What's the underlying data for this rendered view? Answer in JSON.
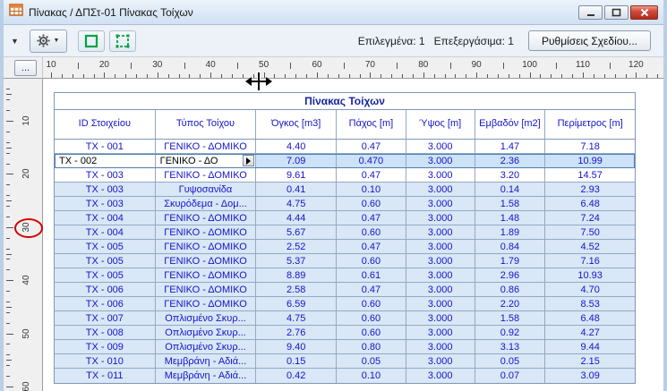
{
  "window": {
    "title": "Πίνακας / ΔΠΣτ-01 Πίνακας Τοίχων"
  },
  "toolbar": {
    "selected_label": "Επιλεγμένα:",
    "selected_count": "1",
    "editable_label": "Επεξεργάσιμα:",
    "editable_count": "1",
    "settings_button_label": "Ρυθμίσεις Σχεδίου..."
  },
  "rulers": {
    "corner_button_label": "...",
    "horizontal_labels": [
      10,
      20,
      30,
      40,
      50,
      60,
      70,
      80,
      90,
      100,
      110,
      120
    ],
    "vertical_labels": [
      10,
      20,
      30,
      40,
      50,
      60
    ]
  },
  "schedule": {
    "title": "Πίνακας Τοίχων",
    "columns": [
      "ID Στοιχείου",
      "Τύπος Τοίχου",
      "Όγκος [m3]",
      "Πάχος [m]",
      "Ύψος [m]",
      "Εμβαδόν [m2]",
      "Περίμετρος [m]"
    ],
    "rows": [
      {
        "id": "ΤΧ - 001",
        "type": "ΓΕΝΙΚΟ - ΔΟΜΙΚΟ",
        "volume": "4.40",
        "thickness": "0.47",
        "height": "3.000",
        "area": "1.47",
        "perimeter": "7.18",
        "state": "plain"
      },
      {
        "id": "ΤΧ - 002",
        "type": "ΓΕΝΙΚΟ - ΔΟ",
        "volume": "7.09",
        "thickness": "0.470",
        "height": "3.000",
        "area": "2.36",
        "perimeter": "10.99",
        "state": "selected"
      },
      {
        "id": "ΤΧ - 003",
        "type": "ΓΕΝΙΚΟ - ΔΟΜΙΚΟ",
        "volume": "9.61",
        "thickness": "0.47",
        "height": "3.000",
        "area": "3.20",
        "perimeter": "14.57",
        "state": "plain"
      },
      {
        "id": "ΤΧ - 003",
        "type": "Γυψοσανίδα",
        "volume": "0.41",
        "thickness": "0.10",
        "height": "3.000",
        "area": "0.14",
        "perimeter": "2.93",
        "state": "shaded"
      },
      {
        "id": "ΤΧ - 003",
        "type": "Σκυρόδεμα - Δομ...",
        "volume": "4.75",
        "thickness": "0.60",
        "height": "3.000",
        "area": "1.58",
        "perimeter": "6.48",
        "state": "shaded"
      },
      {
        "id": "ΤΧ - 004",
        "type": "ΓΕΝΙΚΟ - ΔΟΜΙΚΟ",
        "volume": "4.44",
        "thickness": "0.47",
        "height": "3.000",
        "area": "1.48",
        "perimeter": "7.24",
        "state": "shaded"
      },
      {
        "id": "ΤΧ - 004",
        "type": "ΓΕΝΙΚΟ - ΔΟΜΙΚΟ",
        "volume": "5.67",
        "thickness": "0.60",
        "height": "3.000",
        "area": "1.89",
        "perimeter": "7.50",
        "state": "shaded"
      },
      {
        "id": "ΤΧ - 005",
        "type": "ΓΕΝΙΚΟ - ΔΟΜΙΚΟ",
        "volume": "2.52",
        "thickness": "0.47",
        "height": "3.000",
        "area": "0.84",
        "perimeter": "4.52",
        "state": "shaded"
      },
      {
        "id": "ΤΧ - 005",
        "type": "ΓΕΝΙΚΟ - ΔΟΜΙΚΟ",
        "volume": "5.37",
        "thickness": "0.60",
        "height": "3.000",
        "area": "1.79",
        "perimeter": "7.16",
        "state": "shaded"
      },
      {
        "id": "ΤΧ - 005",
        "type": "ΓΕΝΙΚΟ - ΔΟΜΙΚΟ",
        "volume": "8.89",
        "thickness": "0.61",
        "height": "3.000",
        "area": "2.96",
        "perimeter": "10.93",
        "state": "shaded"
      },
      {
        "id": "ΤΧ - 006",
        "type": "ΓΕΝΙΚΟ - ΔΟΜΙΚΟ",
        "volume": "2.58",
        "thickness": "0.47",
        "height": "3.000",
        "area": "0.86",
        "perimeter": "4.70",
        "state": "shaded"
      },
      {
        "id": "ΤΧ - 006",
        "type": "ΓΕΝΙΚΟ - ΔΟΜΙΚΟ",
        "volume": "6.59",
        "thickness": "0.60",
        "height": "3.000",
        "area": "2.20",
        "perimeter": "8.53",
        "state": "shaded"
      },
      {
        "id": "ΤΧ - 007",
        "type": "Οπλισμένο Σκυρ...",
        "volume": "4.75",
        "thickness": "0.60",
        "height": "3.000",
        "area": "1.58",
        "perimeter": "6.48",
        "state": "shaded"
      },
      {
        "id": "ΤΧ - 008",
        "type": "Οπλισμένο Σκυρ...",
        "volume": "2.76",
        "thickness": "0.60",
        "height": "3.000",
        "area": "0.92",
        "perimeter": "4.27",
        "state": "shaded"
      },
      {
        "id": "ΤΧ - 009",
        "type": "Οπλισμένο Σκυρ...",
        "volume": "9.40",
        "thickness": "0.80",
        "height": "3.000",
        "area": "3.13",
        "perimeter": "9.44",
        "state": "shaded"
      },
      {
        "id": "ΤΧ - 010",
        "type": "Μεμβράνη - Αδιά...",
        "volume": "0.15",
        "thickness": "0.05",
        "height": "3.000",
        "area": "0.05",
        "perimeter": "2.15",
        "state": "shaded"
      },
      {
        "id": "ΤΧ - 011",
        "type": "Μεμβράνη - Αδιά...",
        "volume": "0.42",
        "thickness": "0.10",
        "height": "3.000",
        "area": "0.07",
        "perimeter": "3.09",
        "state": "shaded"
      }
    ]
  },
  "icons": {
    "titlebar": "table-window-icon",
    "toolbar": [
      "caret-down-icon",
      "gear-icon",
      "green-frame-icon",
      "green-dashed-frame-icon"
    ],
    "window_controls": [
      "minimize-icon",
      "maximize-icon",
      "close-icon"
    ]
  },
  "annotations": {
    "cursor": "column-resize-cursor",
    "highlight": "red-ellipse-on-vertical-ruler"
  },
  "colors": {
    "text_blue": "#1414cc",
    "title_blue": "#16259e",
    "grid": "#93a9c4",
    "row_shaded": "#d9e7f6",
    "row_selected": "#cde2f6",
    "selection_border": "#4d7fb5",
    "accent_green": "#00a346",
    "annotation_red": "#d40000",
    "close_red": "#d14b3c"
  }
}
